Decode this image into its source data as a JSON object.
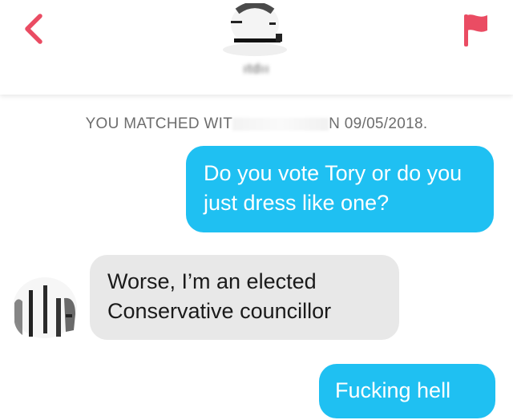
{
  "header": {
    "back_icon": "chevron-left-icon",
    "report_icon": "flag-icon",
    "accent_color": "#ea4c63",
    "match_name_partial": "ıtdıı"
  },
  "match_banner": {
    "prefix": "YOU MATCHED WIT",
    "suffix": "N 09/05/2018."
  },
  "messages": [
    {
      "side": "outgoing",
      "text": "Do you vote Tory or do you just dress like one?"
    },
    {
      "side": "incoming",
      "text": "Worse, I’m an elected Conservative councillor"
    },
    {
      "side": "outgoing",
      "text": "Fucking hell"
    }
  ],
  "colors": {
    "outgoing_bubble": "#1fc0f2",
    "incoming_bubble": "#e8e8e8",
    "banner_text": "#6d6d6d"
  }
}
